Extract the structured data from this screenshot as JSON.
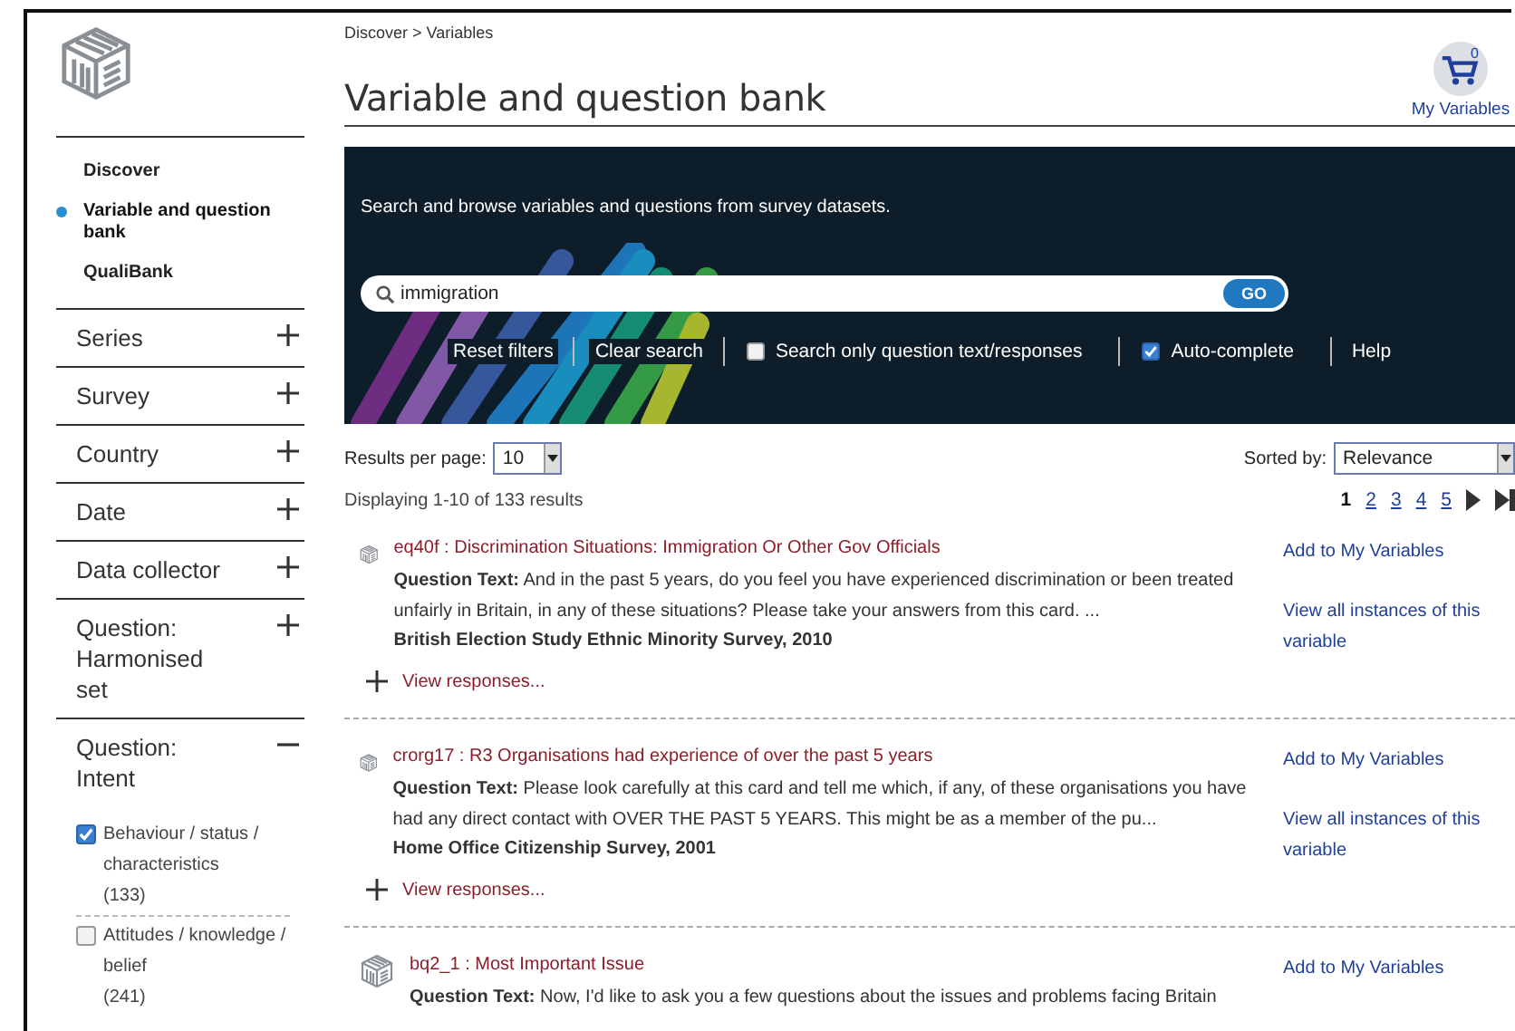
{
  "nav": [
    {
      "label": "Discover",
      "selected": false
    },
    {
      "label": "Variable and question bank",
      "selected": true
    },
    {
      "label": "QualiBank",
      "selected": false
    }
  ],
  "filters": [
    {
      "label": "Series",
      "expanded": false
    },
    {
      "label": "Survey",
      "expanded": false
    },
    {
      "label": "Country",
      "expanded": false
    },
    {
      "label": "Date",
      "expanded": false
    },
    {
      "label": "Data collector",
      "expanded": false
    },
    {
      "label": "Question: Harmonised set",
      "expanded": false
    },
    {
      "label": "Question: Intent",
      "expanded": true,
      "options": [
        {
          "label": "Behaviour / status / characteristics",
          "count": "(133)",
          "checked": true
        },
        {
          "label": "Attitudes / knowledge / belief",
          "count": "(241)",
          "checked": false
        }
      ]
    }
  ],
  "breadcrumb": "Discover > Variables",
  "title": "Variable and question bank",
  "cart": {
    "count": "0",
    "label": "My Variables"
  },
  "banner": {
    "intro": "Search and browse variables and questions from survey datasets.",
    "search": {
      "value": "immigration",
      "button": "GO"
    },
    "links": [
      {
        "kind": "link",
        "label": "Reset filters"
      },
      {
        "kind": "link",
        "label": "Clear search"
      },
      {
        "kind": "checkbox",
        "label": "Search only question text/responses",
        "checked": false
      },
      {
        "kind": "checkbox",
        "label": "Auto-complete",
        "checked": true
      },
      {
        "kind": "link",
        "label": "Help"
      }
    ]
  },
  "results_per_page": {
    "label": "Results per page:",
    "value": "10"
  },
  "sort": {
    "label": "Sorted by:",
    "value": "Relevance"
  },
  "summary": "Displaying 1-10 of 133 results",
  "pages": [
    {
      "label": "1",
      "selected": true
    },
    {
      "label": "2",
      "selected": false
    },
    {
      "label": "3",
      "selected": false
    },
    {
      "label": "4",
      "selected": false
    },
    {
      "label": "5",
      "selected": false
    }
  ],
  "results": [
    {
      "title": "eq40f : Discrimination Situations: Immigration Or Other Gov Officials",
      "question": "**Question Text:** And in the past 5 years, do you feel you have experienced discrimination or been treated unfairly in Britain, in any of these situations? Please take your answers from this card. ...",
      "survey": "British Election Study Ethnic Minority Survey, 2010",
      "responses": "View responses...",
      "add": "Add to My Variables",
      "instances": "View all instances of this variable"
    },
    {
      "title": "crorg17 : R3 Organisations had experience of over the past 5 years",
      "question": "**Question Text:** Please look carefully at this card and tell me which, if any, of these organisations you have had any direct contact with OVER THE PAST 5 YEARS. This might be as a member of the pu...",
      "survey": "Home Office Citizenship Survey, 2001",
      "responses": "View responses...",
      "add": "Add to My Variables",
      "instances": "View all instances of this variable"
    },
    {
      "title": "bq2_1 : Most Important Issue",
      "question": "**Question Text:** Now, I'd like to ask you a few questions about the issues and problems facing Britain",
      "add": "Add to My Variables"
    }
  ]
}
